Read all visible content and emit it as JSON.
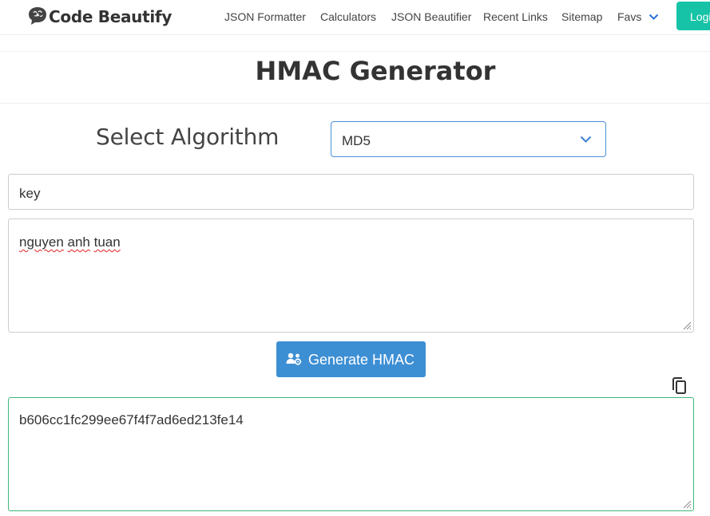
{
  "header": {
    "logo_text": "Code Beautify",
    "nav": [
      "JSON Formatter",
      "Calculators",
      "JSON Beautifier",
      "Recent Links",
      "Sitemap",
      "Favs"
    ],
    "login_label": "Logi"
  },
  "page": {
    "title": "HMAC Generator"
  },
  "form": {
    "algorithm_label": "Select Algorithm",
    "algorithm_value": "MD5",
    "key_value": "key",
    "message_words": [
      "nguyen",
      "anh",
      "tuan"
    ],
    "generate_label": "Generate HMAC",
    "output_value": "b606cc1fc299ee67f4f7ad6ed213fe14"
  },
  "colors": {
    "brand_button": "#17c3a7",
    "generate_button": "#3d8fd4",
    "select_border": "#4a90d9",
    "output_border": "#3db87a"
  },
  "icons": [
    "brain-logo-icon",
    "chevron-down-icon",
    "users-gear-icon",
    "copy-icon",
    "resize-handle-icon"
  ]
}
